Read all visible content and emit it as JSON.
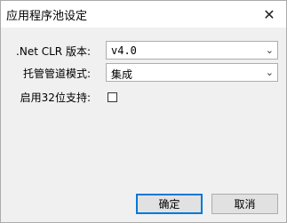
{
  "window": {
    "title": "应用程序池设定",
    "close_icon": "close-icon"
  },
  "form": {
    "clr_label": ".Net CLR 版本:",
    "clr_value": "v4.0",
    "pipeline_label": "托管管道模式:",
    "pipeline_value": "集成",
    "enable32_label": "启用32位支持:",
    "enable32_checked": false
  },
  "buttons": {
    "ok_label": "确定",
    "cancel_label": "取消"
  }
}
